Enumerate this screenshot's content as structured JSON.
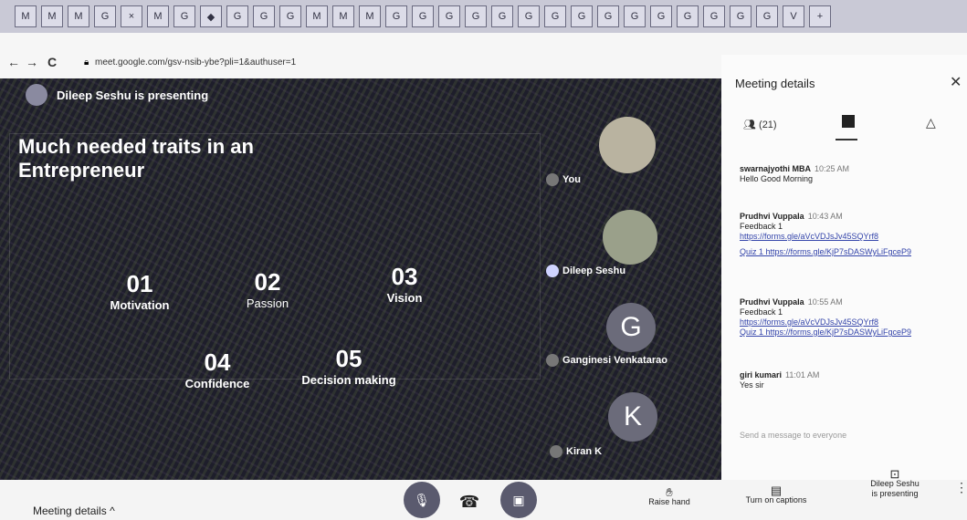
{
  "browser": {
    "tab_labels": [
      "M",
      "M",
      "M",
      "G",
      "×",
      "M",
      "G",
      "◆",
      "G",
      "G",
      "G",
      "M",
      "M",
      "M",
      "G",
      "G",
      "G",
      "G",
      "G",
      "G",
      "G",
      "G",
      "G",
      "G",
      "G",
      "G",
      "G",
      "G",
      "G",
      "V",
      "+"
    ],
    "url": "meet.google.com/gsv-nsib-ybe?pli=1&authuser=1",
    "back": "←",
    "forward": "→",
    "reload": "C"
  },
  "stage": {
    "presenter_banner": "Dileep Seshu is presenting",
    "slide_title": "Much needed traits in an Entrepreneur",
    "traits": [
      {
        "num": "01",
        "label": "Motivation"
      },
      {
        "num": "02",
        "label": "Passion"
      },
      {
        "num": "03",
        "label": "Vision"
      },
      {
        "num": "04",
        "label": "Confidence"
      },
      {
        "num": "05",
        "label": "Decision making"
      }
    ]
  },
  "participants": [
    {
      "name": "You",
      "initial": ""
    },
    {
      "name": "Dileep Seshu",
      "initial": ""
    },
    {
      "name": "Ganginesi Venkatarao",
      "initial": "G"
    },
    {
      "name": "Kiran K",
      "initial": "K"
    }
  ],
  "side_panel": {
    "title": "Meeting details",
    "people_count": "(21)",
    "messages": [
      {
        "sender": "swarnajyothi MBA",
        "time": "10:25 AM",
        "lines": [
          "Hello Good Morning"
        ],
        "links": []
      },
      {
        "sender": "Prudhvi Vuppala",
        "time": "10:43 AM",
        "lines": [
          "Feedback 1"
        ],
        "links": [
          "https://forms.gle/aVcVDJsJv45SQYrf8",
          "Quiz 1 https://forms.gle/KjP7sDASWyLiFgceP9"
        ]
      },
      {
        "sender": "Prudhvi Vuppala",
        "time": "10:55 AM",
        "lines": [
          "Feedback 1"
        ],
        "links": [
          "https://forms.gle/aVcVDJsJv45SQYrf8",
          "Quiz 1 https://forms.gle/KjP7sDASWyLiFgceP9"
        ]
      },
      {
        "sender": "giri kumari",
        "time": "11:01 AM",
        "lines": [
          "Yes sir"
        ],
        "links": []
      }
    ],
    "compose_placeholder": "Send a message to everyone"
  },
  "bottom_bar": {
    "meeting_details": "Meeting details",
    "raise_hand": "Raise hand",
    "captions": "Turn on captions",
    "presenting_line1": "Dileep Seshu",
    "presenting_line2": "is presenting"
  },
  "colors": {
    "stage_bg": "#1c1d24",
    "control_red": "#5c5c70",
    "accent": "#3344aa"
  }
}
